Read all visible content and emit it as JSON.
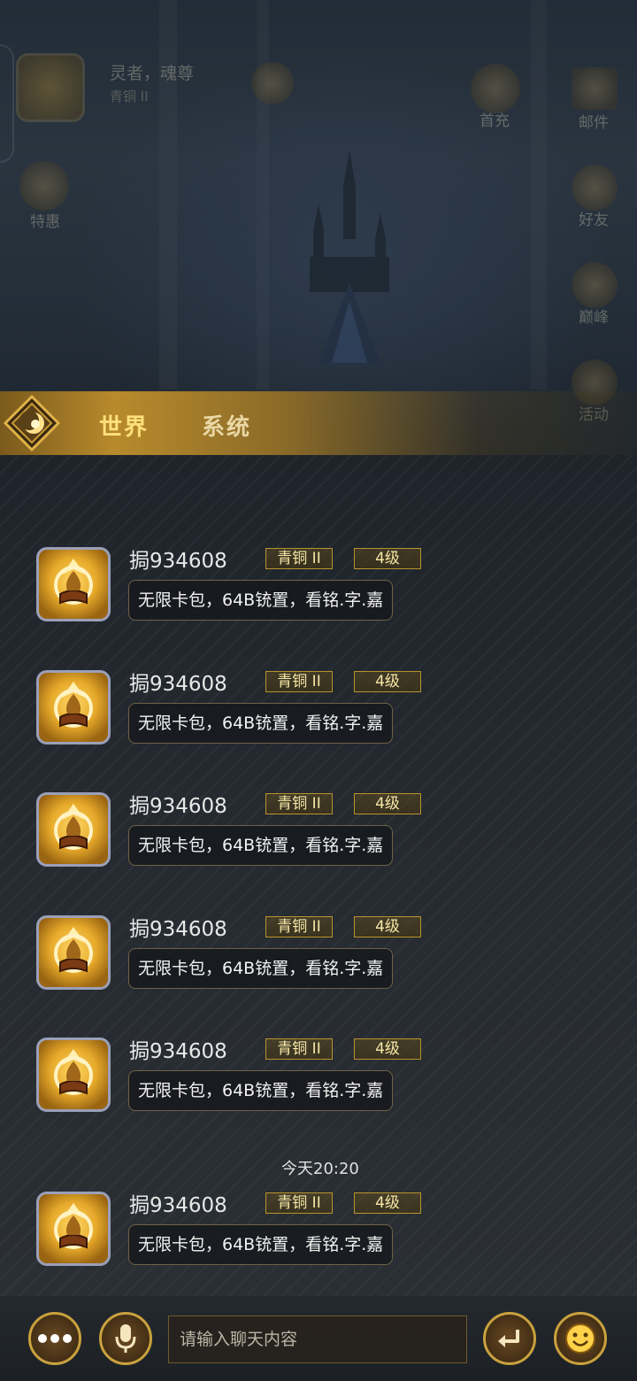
{
  "hud": {
    "player_name": "灵者，魂尊",
    "player_rank": "青铜 II",
    "left_icons": [
      {
        "label": "特惠"
      }
    ],
    "right_icons": [
      {
        "label": "首充"
      },
      {
        "label": "邮件"
      },
      {
        "label": "好友"
      },
      {
        "label": "巅峰"
      },
      {
        "label": "活动"
      }
    ]
  },
  "tabs": {
    "world": "世界",
    "system": "系统"
  },
  "messages": [
    {
      "username": "",
      "rank": "",
      "level": "",
      "text": "无限卡包，64B铳置，看铭.字.嘉"
    },
    {
      "username": "挶934608",
      "rank": "青铜 II",
      "level": "4级",
      "text": "无限卡包，64B铳置，看铭.字.嘉"
    },
    {
      "username": "挶934608",
      "rank": "青铜 II",
      "level": "4级",
      "text": "无限卡包，64B铳置，看铭.字.嘉"
    },
    {
      "username": "挶934608",
      "rank": "青铜 II",
      "level": "4级",
      "text": "无限卡包，64B铳置，看铭.字.嘉"
    },
    {
      "username": "挶934608",
      "rank": "青铜 II",
      "level": "4级",
      "text": "无限卡包，64B铳置，看铭.字.嘉"
    },
    {
      "username": "挶934608",
      "rank": "青铜 II",
      "level": "4级",
      "text": "无限卡包，64B铳置，看铭.字.嘉"
    },
    {
      "username": "挶934608",
      "rank": "青铜 II",
      "level": "4级",
      "text": "无限卡包，64B铳置，看铭.字.嘉"
    }
  ],
  "timestamp": "今天20:20",
  "input": {
    "placeholder": "请输入聊天内容"
  },
  "buttons": {
    "more_icon": "more-dots-icon",
    "mic_icon": "microphone-icon",
    "send_icon": "return-icon",
    "emoji_icon": "smiley-icon"
  },
  "colors": {
    "gold": "#c9a13e",
    "badge_text": "#f6e6a6",
    "active_tab": "#ffe07a"
  }
}
